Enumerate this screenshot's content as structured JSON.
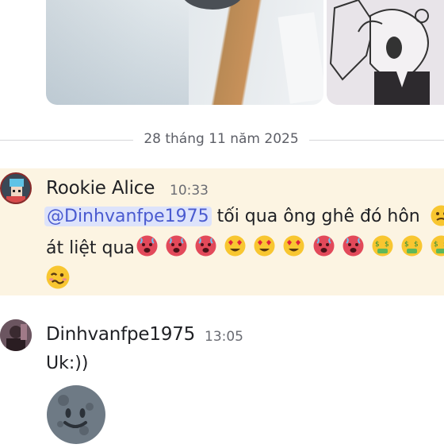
{
  "date_divider": "28 tháng 11 năm 2025",
  "messages": [
    {
      "author": "Rookie Alice",
      "time": "10:33",
      "mention": "@Dinhvanfpe1975",
      "text_line1": " tối qua ông ghê đó hôn",
      "text_line2": "át liệt qua",
      "emojis": [
        "hot-face",
        "hot-face",
        "hot-face",
        "heart-eyes",
        "heart-eyes",
        "heart-eyes",
        "hot-face",
        "hot-face",
        "money-mouth",
        "money-mouth",
        "money-mouth"
      ],
      "trailing_emoji": "woozy-face"
    },
    {
      "author": "Dinhvanfpe1975",
      "time": "13:05",
      "text": "Uk:))",
      "sticker": "moon-face-sticker"
    }
  ],
  "colors": {
    "highlight_bg": "#fcf4e2",
    "mention_bg": "#dde3fb",
    "mention_text": "#4a5bd0"
  }
}
